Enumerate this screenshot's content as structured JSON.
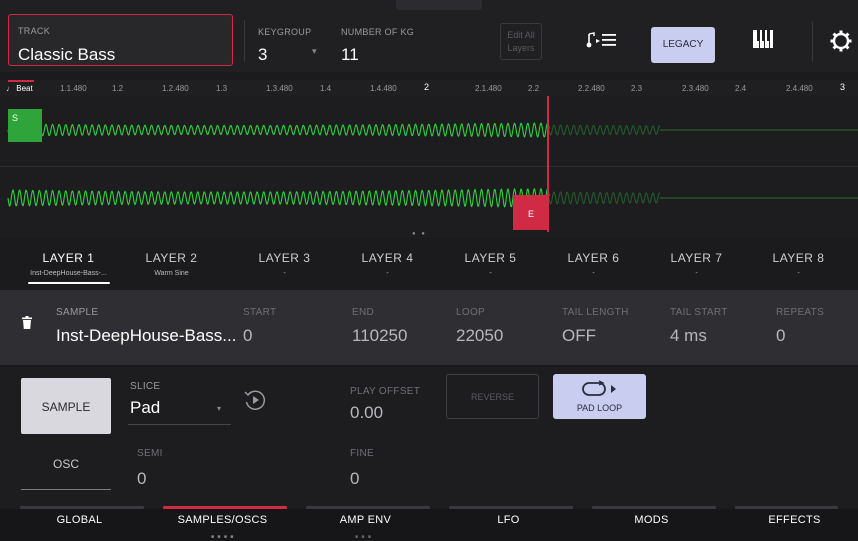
{
  "header": {
    "track_label": "TRACK",
    "track_value": "Classic Bass",
    "keygroup_label": "KEYGROUP",
    "keygroup_value": "3",
    "num_kg_label": "NUMBER OF KG",
    "num_kg_value": "11",
    "edit_all_layers": "Edit All Layers",
    "legacy_label": "LEGACY"
  },
  "ruler": {
    "start_label": "Beat",
    "ticks": [
      "1.1.480",
      "1.2",
      "1.2.480",
      "1.3",
      "1.3.480",
      "1.4",
      "1.4.480",
      "2",
      "2.1.480",
      "2.2",
      "2.2.480",
      "2.3",
      "2.3.480",
      "2.4",
      "2.4.480",
      "3"
    ]
  },
  "waveform": {
    "start_marker": "S",
    "end_marker": "E",
    "wave_color": "#2fd13c",
    "marker_start_color": "#2fa43a",
    "playhead_color": "#d02a44"
  },
  "layers": [
    {
      "title": "LAYER 1",
      "sample": "Inst-DeepHouse-Bass-..."
    },
    {
      "title": "LAYER 2",
      "sample": "Warm Sine"
    },
    {
      "title": "LAYER 3",
      "sample": "-"
    },
    {
      "title": "LAYER 4",
      "sample": "-"
    },
    {
      "title": "LAYER 5",
      "sample": "-"
    },
    {
      "title": "LAYER 6",
      "sample": "-"
    },
    {
      "title": "LAYER 7",
      "sample": "-"
    },
    {
      "title": "LAYER 8",
      "sample": "-"
    }
  ],
  "sample_panel": {
    "sample_label": "SAMPLE",
    "sample_value": "Inst-DeepHouse-Bass...",
    "params": [
      {
        "label": "START",
        "value": "0"
      },
      {
        "label": "END",
        "value": "110250"
      },
      {
        "label": "LOOP",
        "value": "22050"
      },
      {
        "label": "TAIL LENGTH",
        "value": "OFF"
      },
      {
        "label": "TAIL START",
        "value": "4 ms"
      },
      {
        "label": "REPEATS",
        "value": "0"
      }
    ]
  },
  "controls": {
    "sample_button": "SAMPLE",
    "osc_button": "OSC",
    "slice_label": "SLICE",
    "slice_value": "Pad",
    "play_offset_label": "PLAY OFFSET",
    "play_offset_value": "0.00",
    "reverse_label": "REVERSE",
    "pad_loop_label": "PAD LOOP",
    "semi_label": "SEMI",
    "semi_value": "0",
    "fine_label": "FINE",
    "fine_value": "0"
  },
  "nav": {
    "items": [
      "GLOBAL",
      "SAMPLES/OSCS",
      "AMP ENV",
      "LFO",
      "MODS",
      "EFFECTS"
    ],
    "accent": "#d02a44"
  }
}
